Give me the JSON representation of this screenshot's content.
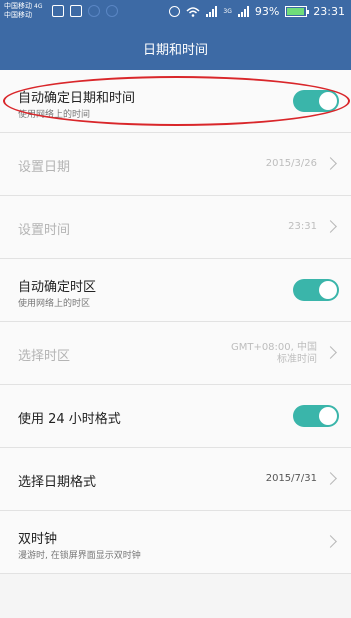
{
  "status_bar": {
    "carrier1": "中国移动",
    "carrier1_net": "4G",
    "carrier2": "中国移动",
    "signal_label": "3G",
    "battery": "93%",
    "battery_fraction": 0.93,
    "time": "23:31",
    "accent": "#3d6aa5"
  },
  "header": {
    "title": "日期和时间"
  },
  "settings": {
    "auto_datetime": {
      "title": "自动确定日期和时间",
      "sub": "使用网络上的时间",
      "enabled": true
    },
    "set_date": {
      "title": "设置日期",
      "value": "2015/3/26"
    },
    "set_time": {
      "title": "设置时间",
      "value": "23:31"
    },
    "auto_timezone": {
      "title": "自动确定时区",
      "sub": "使用网络上的时区",
      "enabled": true
    },
    "select_timezone": {
      "title": "选择时区",
      "value_line1": "GMT+08:00, 中国",
      "value_line2": "标准时间"
    },
    "use_24h": {
      "title": "使用 24 小时格式",
      "enabled": true
    },
    "date_format": {
      "title": "选择日期格式",
      "value": "2015/7/31"
    },
    "dual_clock": {
      "title": "双时钟",
      "sub": "漫游时, 在锁屏界面显示双时钟"
    }
  },
  "toggle_color": "#3ab5aa"
}
